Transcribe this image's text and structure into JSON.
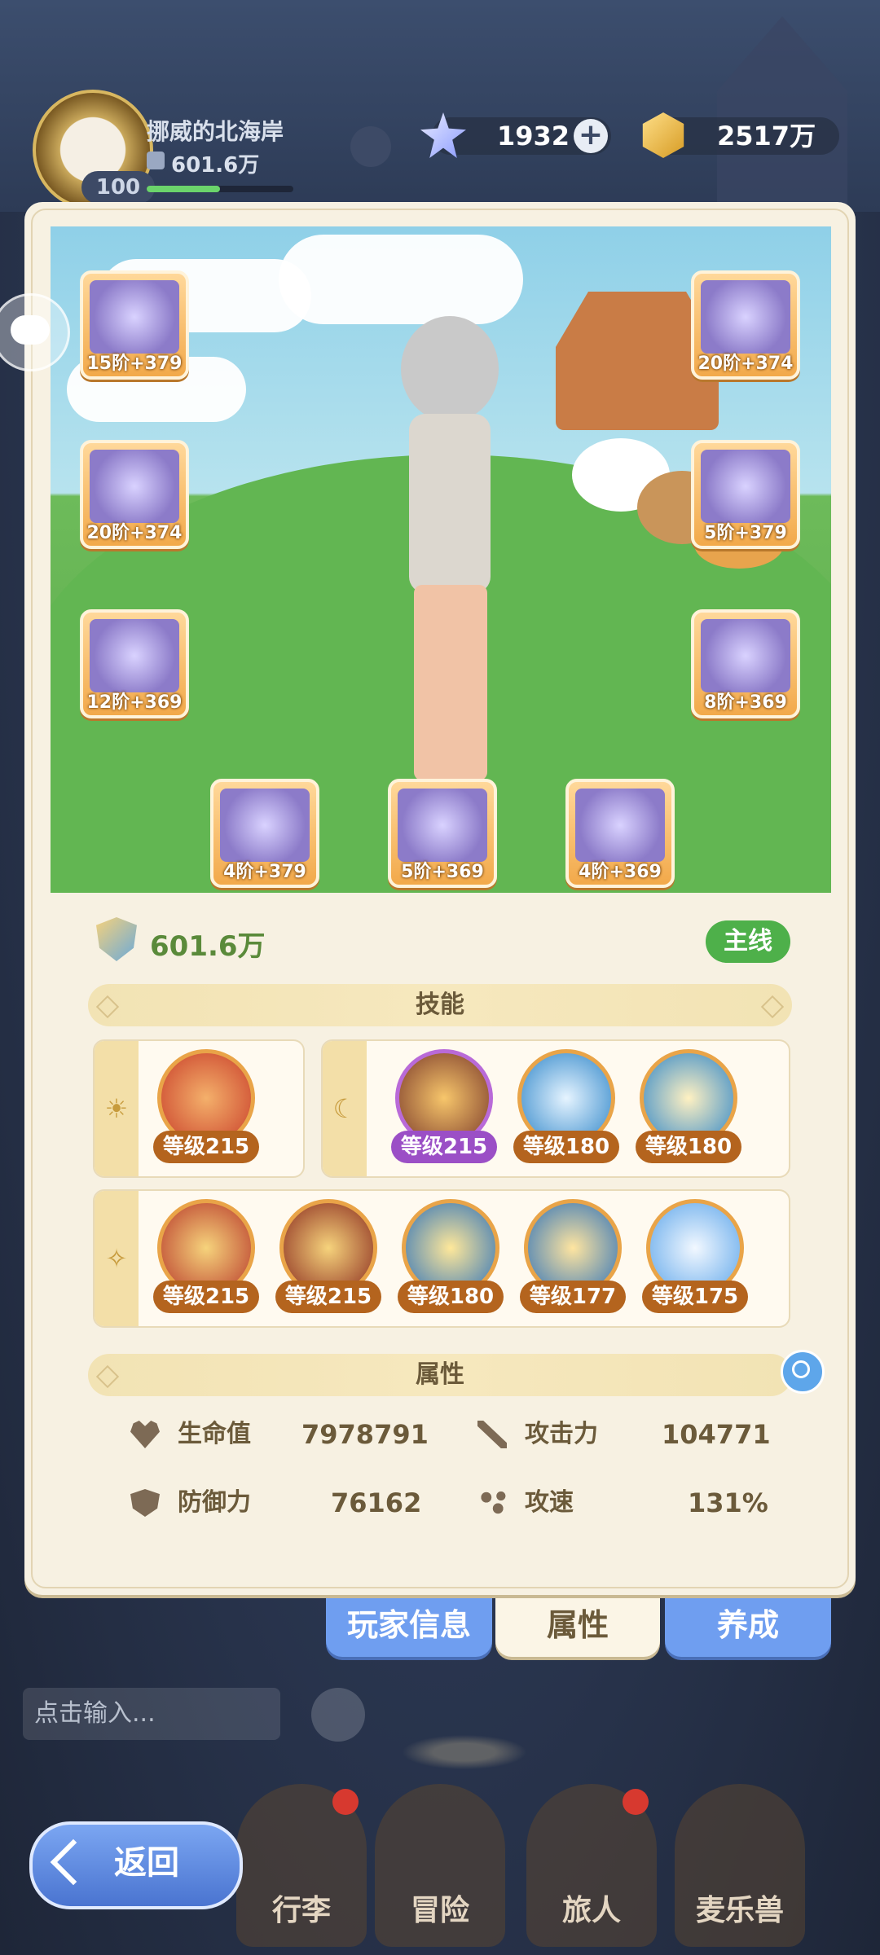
{
  "player": {
    "name": "挪威的北海岸",
    "power": "601.6万",
    "level": "100"
  },
  "resources": {
    "gems": "1932",
    "gold": "2517万"
  },
  "equipment": [
    {
      "label": "15阶+379",
      "icon": "weapon-icon"
    },
    {
      "label": "20阶+374",
      "icon": "helmet-icon"
    },
    {
      "label": "20阶+374",
      "icon": "armor-icon"
    },
    {
      "label": "5阶+379",
      "icon": "gauntlet-icon"
    },
    {
      "label": "12阶+369",
      "icon": "belt-icon"
    },
    {
      "label": "8阶+369",
      "icon": "boots-icon"
    },
    {
      "label": "4阶+379",
      "icon": "ring-icon"
    },
    {
      "label": "5阶+369",
      "icon": "necklace-icon"
    },
    {
      "label": "4阶+369",
      "icon": "amulet-icon"
    }
  ],
  "combat_power": "601.6万",
  "mainline_badge": "主线",
  "sections": {
    "skills": "技能",
    "attributes": "属性"
  },
  "skills": {
    "sun_group": [
      {
        "level": "等级215"
      }
    ],
    "moon_group": [
      {
        "level": "等级215"
      },
      {
        "level": "等级180"
      },
      {
        "level": "等级180"
      }
    ],
    "star_group": [
      {
        "level": "等级215"
      },
      {
        "level": "等级215"
      },
      {
        "level": "等级180"
      },
      {
        "level": "等级177"
      },
      {
        "level": "等级175"
      }
    ]
  },
  "attributes": {
    "hp_label": "生命值",
    "hp_value": "7978791",
    "atk_label": "攻击力",
    "atk_value": "104771",
    "def_label": "防御力",
    "def_value": "76162",
    "spd_label": "攻速",
    "spd_value": "131%"
  },
  "tabs": {
    "info": "玩家信息",
    "attributes": "属性",
    "grow": "养成"
  },
  "chat": {
    "placeholder": "点击输入..."
  },
  "nav": {
    "back": "返回",
    "luggage": "行李",
    "adventure": "冒险",
    "traveler": "旅人",
    "pet": "麦乐兽"
  }
}
